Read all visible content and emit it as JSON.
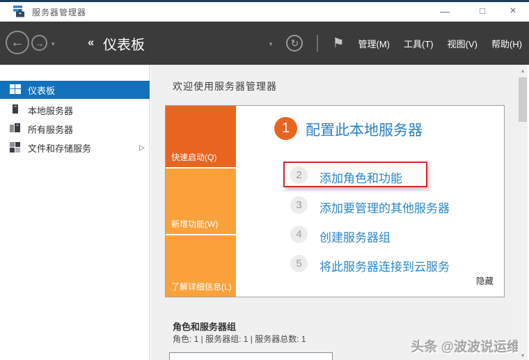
{
  "window": {
    "title": "服务器管理器",
    "minimize_icon": "—",
    "maximize_icon": "□",
    "close_icon": "×"
  },
  "navbar": {
    "back_icon": "←",
    "forward_icon": "→",
    "dropdown_icon": "▾",
    "breadcrumb_chevrons": "‹‹",
    "breadcrumb": "仪表板",
    "refresh_icon": "↻",
    "flag_icon": "⚑",
    "menus": [
      {
        "label": "管理(M)"
      },
      {
        "label": "工具(T)"
      },
      {
        "label": "视图(V)"
      },
      {
        "label": "帮助(H)"
      }
    ]
  },
  "sidebar": {
    "items": [
      {
        "label": "仪表板",
        "selected": true
      },
      {
        "label": "本地服务器",
        "selected": false
      },
      {
        "label": "所有服务器",
        "selected": false
      },
      {
        "label": "文件和存储服务",
        "selected": false,
        "expander_icon": "▷"
      }
    ]
  },
  "main": {
    "welcome_heading": "欢迎使用服务器管理器",
    "quick_tiles": [
      {
        "label": "快速启动(Q)",
        "color": "#e8651f"
      },
      {
        "label": "新增功能(W)",
        "color": "#f9a23c"
      },
      {
        "label": "了解详细信息(L)",
        "color": "#f9a23c"
      }
    ],
    "steps": [
      {
        "num": "1",
        "label": "配置此本地服务器"
      },
      {
        "num": "2",
        "label": "添加角色和功能",
        "annotated": true
      },
      {
        "num": "3",
        "label": "添加要管理的其他服务器"
      },
      {
        "num": "4",
        "label": "创建服务器组"
      },
      {
        "num": "5",
        "label": "将此服务器连接到云服务"
      }
    ],
    "hide_label": "隐藏",
    "roles_section": {
      "title": "角色和服务器组",
      "summary": "角色: 1 | 服务器组: 1 | 服务器总数: 1"
    }
  },
  "watermark": "头条 @波波说运维",
  "scrollbar": {
    "up_icon": "▴",
    "down_icon": "▾"
  },
  "colors": {
    "accent_blue": "#1271b8",
    "link_blue": "#2b87c8",
    "tile_orange_dark": "#e8651f",
    "tile_orange_light": "#f9a23c",
    "annotation_red": "#cf2a24",
    "navbar_dark": "#3b3b3b",
    "titlebar_top_line": "#1c3c55"
  }
}
